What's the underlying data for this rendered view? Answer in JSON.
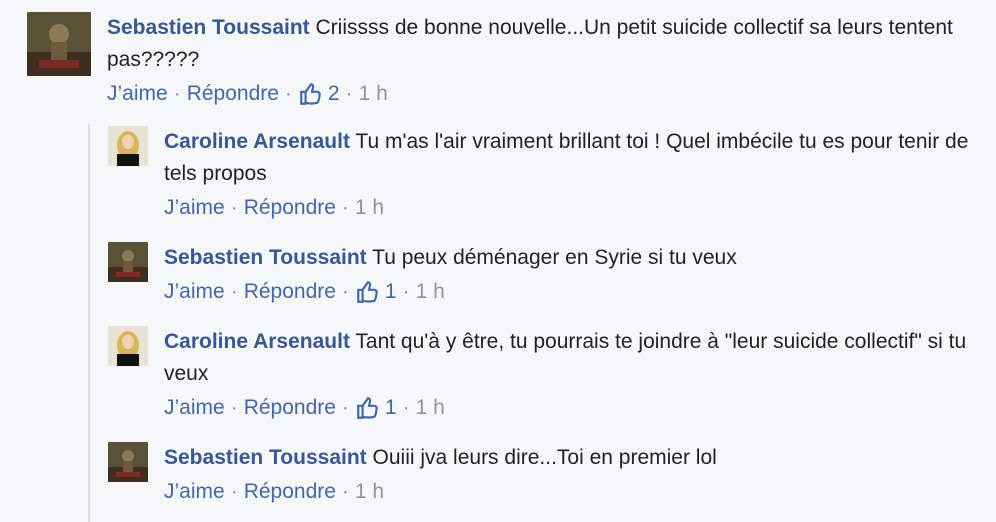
{
  "colors": {
    "author": "#365899",
    "link": "#4267b2",
    "meta": "#90949c",
    "text": "#1d2129",
    "background": "#f6f7f9"
  },
  "icons": {
    "like": "thumbs-up-icon"
  },
  "comments": [
    {
      "author": "Sebastien Toussaint",
      "text": "Criissss de bonne nouvelle...Un petit suicide collectif sa leurs tentent pas?????",
      "like_label": "J’aime",
      "reply_label": "Répondre",
      "likes": "2",
      "time": "1 h"
    },
    {
      "author": "Caroline Arsenault",
      "text": "Tu m'as l'air vraiment brillant toi ! Quel imbécile tu es pour tenir de tels propos",
      "like_label": "J’aime",
      "reply_label": "Répondre",
      "time": "1 h"
    },
    {
      "author": "Sebastien Toussaint",
      "text": "Tu peux déménager en Syrie si tu veux",
      "like_label": "J’aime",
      "reply_label": "Répondre",
      "likes": "1",
      "time": "1 h"
    },
    {
      "author": "Caroline Arsenault",
      "text": "Tant qu'à y être, tu pourrais te joindre à \"leur suicide collectif\" si tu veux",
      "like_label": "J’aime",
      "reply_label": "Répondre",
      "likes": "1",
      "time": "1 h"
    },
    {
      "author": "Sebastien Toussaint",
      "text": "Ouiii jva leurs dire...Toi en premier lol",
      "like_label": "J’aime",
      "reply_label": "Répondre",
      "time": "1 h"
    }
  ]
}
